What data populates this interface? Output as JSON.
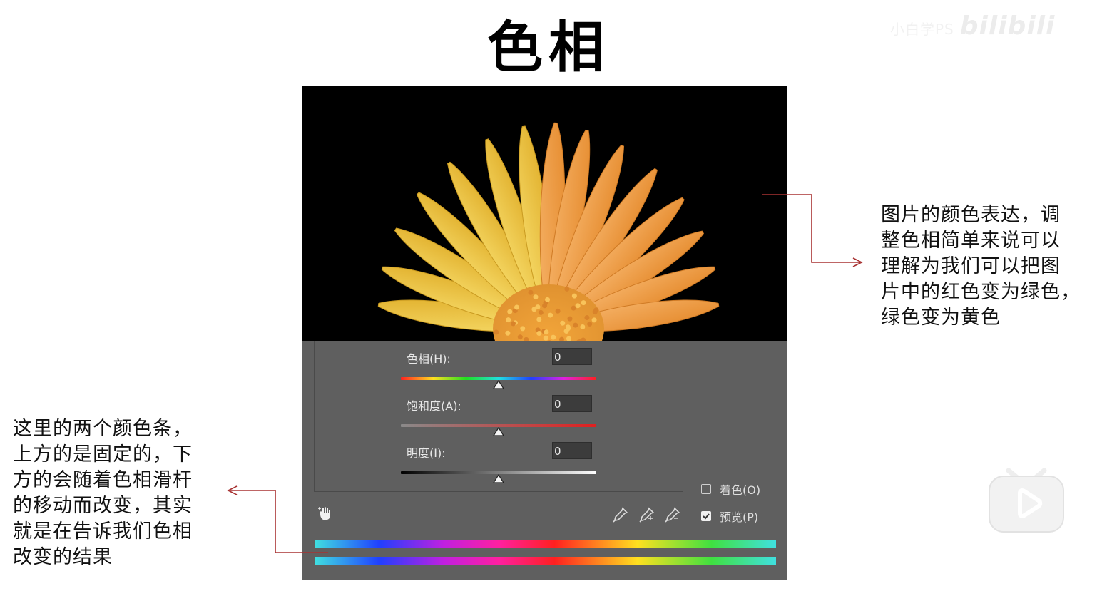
{
  "title": "色相",
  "watermark": {
    "uploader": "小白学PS",
    "brand": "bilibili"
  },
  "dialog": {
    "hue": {
      "label": "色相(H):",
      "value": "0",
      "level": 0.5
    },
    "saturation": {
      "label": "饱和度(A):",
      "value": "0",
      "level": 0.5
    },
    "lightness": {
      "label": "明度(I):",
      "value": "0",
      "level": 0.5
    },
    "colorize": {
      "label": "着色(O)",
      "checked": false
    },
    "preview": {
      "label": "预览(P)",
      "checked": true
    },
    "icons": [
      "hand-adjust-icon",
      "eyedropper-icon",
      "eyedropper-plus-icon",
      "eyedropper-minus-icon"
    ]
  },
  "annotations": {
    "right": [
      "图片的颜色表达，调",
      "整色相简单来说可以",
      "理解为我们可以把图",
      "片中的红色变为绿色，",
      "绿色变为黄色"
    ],
    "left": [
      "这里的两个颜色条，",
      "上方的是固定的，下",
      "方的会随着色相滑杆",
      "的移动而改变，其实",
      "就是在告诉我们色相",
      "改变的结果"
    ]
  },
  "colors": {
    "annotation_arrow": "#a83232",
    "panel_bg": "#5f5f5f"
  }
}
